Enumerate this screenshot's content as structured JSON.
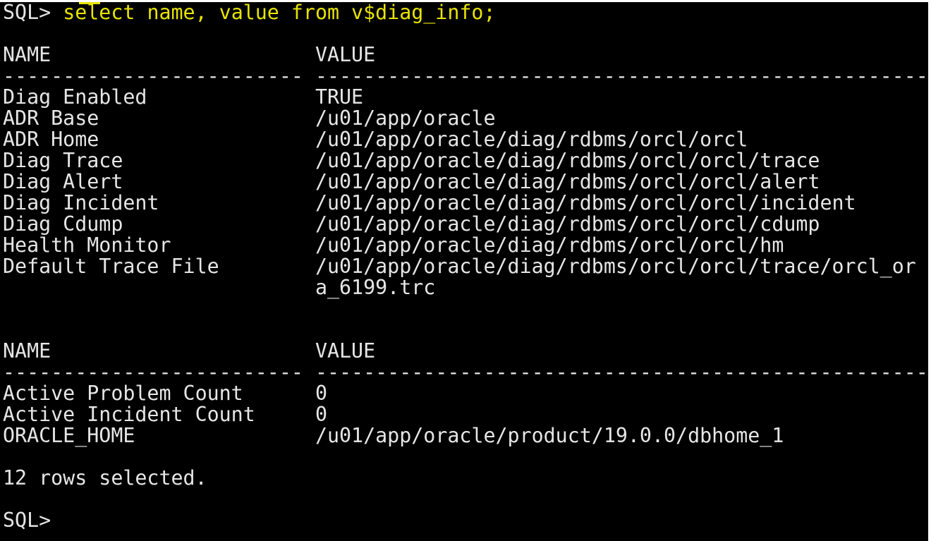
{
  "colors": {
    "background": "#000000",
    "text": "#e6e6e6",
    "command": "#e8e400"
  },
  "terminal": {
    "prompt": "SQL> ",
    "command": "select name, value from v$diag_info;",
    "header": {
      "name": "NAME",
      "value": "VALUE",
      "separator": "------------------------- -----------------------------------------------------"
    },
    "rows_part1": [
      {
        "name": "Diag Enabled",
        "value": "TRUE"
      },
      {
        "name": "ADR Base",
        "value": "/u01/app/oracle"
      },
      {
        "name": "ADR Home",
        "value": "/u01/app/oracle/diag/rdbms/orcl/orcl"
      },
      {
        "name": "Diag Trace",
        "value": "/u01/app/oracle/diag/rdbms/orcl/orcl/trace"
      },
      {
        "name": "Diag Alert",
        "value": "/u01/app/oracle/diag/rdbms/orcl/orcl/alert"
      },
      {
        "name": "Diag Incident",
        "value": "/u01/app/oracle/diag/rdbms/orcl/orcl/incident"
      },
      {
        "name": "Diag Cdump",
        "value": "/u01/app/oracle/diag/rdbms/orcl/orcl/cdump"
      },
      {
        "name": "Health Monitor",
        "value": "/u01/app/oracle/diag/rdbms/orcl/orcl/hm"
      },
      {
        "name": "Default Trace File",
        "value": "/u01/app/oracle/diag/rdbms/orcl/orcl/trace/orcl_or",
        "wrap": "a_6199.trc"
      }
    ],
    "rows_part2": [
      {
        "name": "Active Problem Count",
        "value": "0"
      },
      {
        "name": "Active Incident Count",
        "value": "0"
      },
      {
        "name": "ORACLE_HOME",
        "value": "/u01/app/oracle/product/19.0.0/dbhome_1"
      }
    ],
    "summary": "12 rows selected.",
    "final_prompt": "SQL>"
  }
}
